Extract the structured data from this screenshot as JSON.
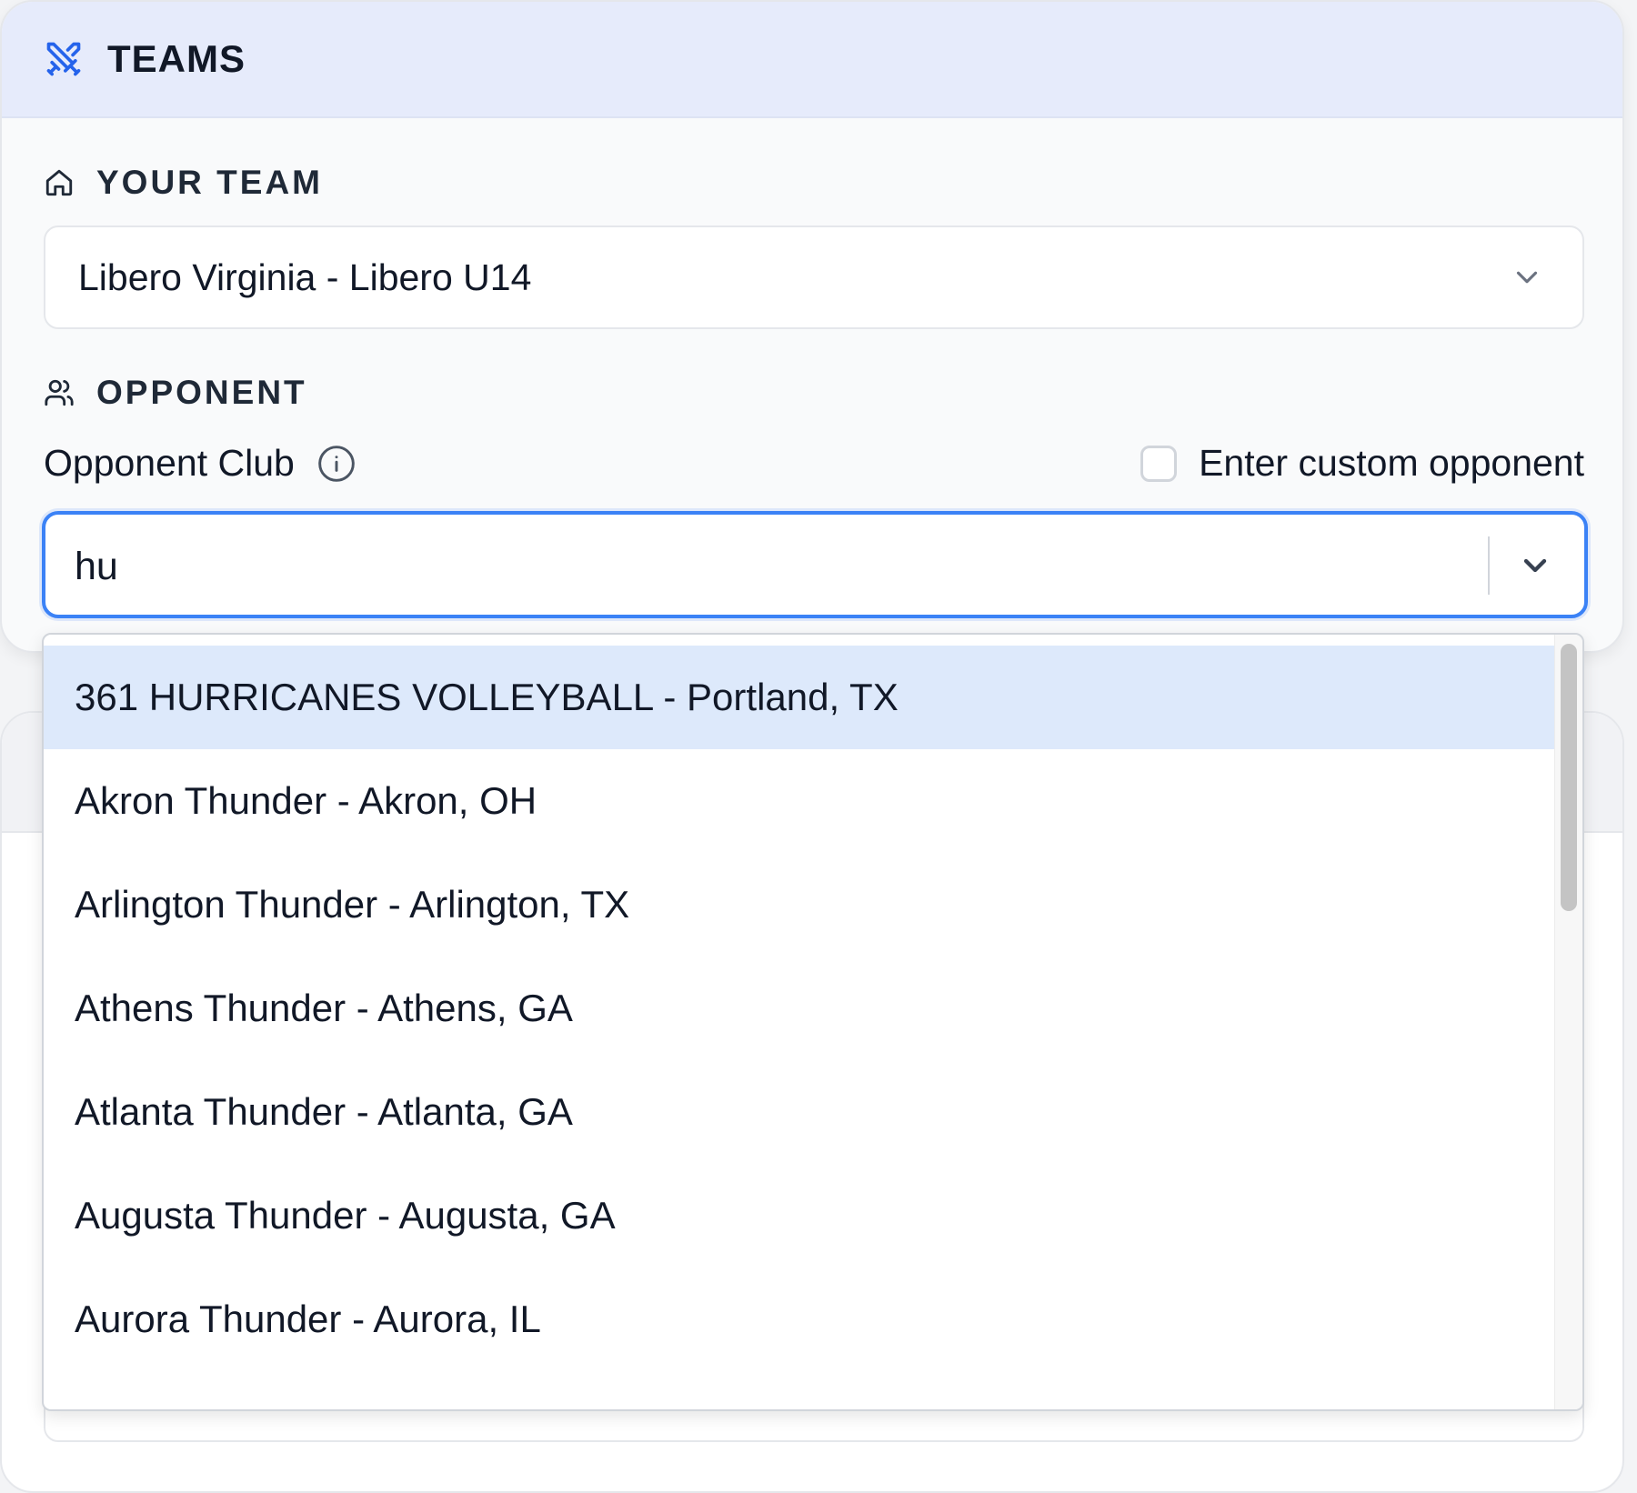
{
  "header": {
    "title": "TEAMS",
    "icon": "crossed-swords-icon"
  },
  "your_team": {
    "label": "YOUR TEAM",
    "icon": "home-icon",
    "selected_value": "Libero Virginia - Libero U14"
  },
  "opponent": {
    "label": "OPPONENT",
    "icon": "users-icon",
    "club_label": "Opponent Club",
    "custom_checkbox_label": "Enter custom opponent",
    "custom_checked": false,
    "search_value": "hu",
    "options": [
      "361 HURRICANES VOLLEYBALL - Portland, TX",
      "Akron Thunder - Akron, OH",
      "Arlington Thunder - Arlington, TX",
      "Athens Thunder - Athens, GA",
      "Atlanta Thunder - Atlanta, GA",
      "Augusta Thunder - Augusta, GA",
      "Aurora Thunder - Aurora, IL"
    ],
    "highlighted_index": 0
  },
  "colors": {
    "accent": "#3b82f6",
    "header_bg": "#e6ebfb",
    "highlight_bg": "#dde9fb"
  }
}
